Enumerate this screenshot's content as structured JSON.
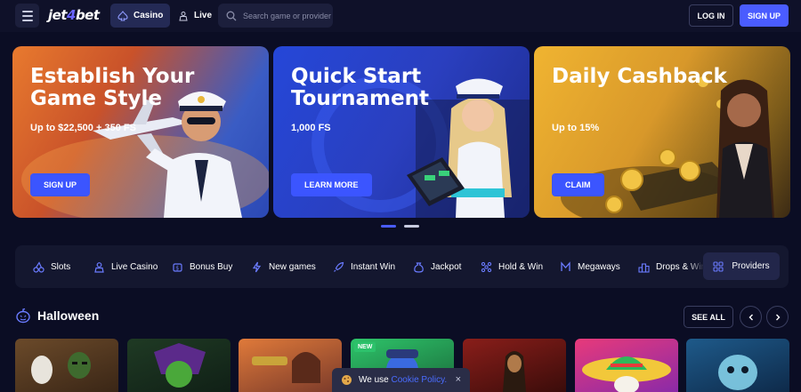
{
  "header": {
    "logo": {
      "prefix": "jet",
      "num": "4",
      "suffix": "bet"
    },
    "nav": [
      {
        "label": "Casino",
        "icon": "spade-icon"
      },
      {
        "label": "Live",
        "icon": "dealer-icon"
      }
    ],
    "search_placeholder": "Search game or provider",
    "login_label": "LOG IN",
    "signup_label": "SIGN UP"
  },
  "banners": [
    {
      "title": "Establish Your Game Style",
      "subtitle": "Up to $22,500 + 350 FS",
      "cta": "SIGN UP",
      "art": "pilot-with-airplane"
    },
    {
      "title": "Quick Start Tournament",
      "subtitle": "1,000 FS",
      "cta": "LEARN MORE",
      "art": "stewardess-with-tablet"
    },
    {
      "title": "Daily Cashback",
      "subtitle": "Up to 15%",
      "cta": "CLAIM",
      "art": "woman-with-gold-coins"
    }
  ],
  "carousel": {
    "slides": 2,
    "active": 1
  },
  "categories": [
    {
      "label": "Slots",
      "icon": "cherries-icon"
    },
    {
      "label": "Live Casino",
      "icon": "dealer-icon"
    },
    {
      "label": "Bonus Buy",
      "icon": "money-bag-icon"
    },
    {
      "label": "New games",
      "icon": "lightning-icon"
    },
    {
      "label": "Instant Win",
      "icon": "rocket-icon"
    },
    {
      "label": "Jackpot",
      "icon": "coin-bag-icon"
    },
    {
      "label": "Hold & Win",
      "icon": "grid-dots-icon"
    },
    {
      "label": "Megaways",
      "icon": "m-letter-icon"
    },
    {
      "label": "Drops & Wins",
      "icon": "podium-icon"
    }
  ],
  "providers_label": "Providers",
  "section": {
    "title": "Halloween",
    "icon": "pumpkin-icon",
    "see_all_label": "SEE ALL"
  },
  "games": [
    {
      "art": "zombie-clowns",
      "badge": ""
    },
    {
      "art": "green-skull-wizard",
      "badge": ""
    },
    {
      "art": "gunslinger-girl",
      "badge": ""
    },
    {
      "art": "blue-bird-character",
      "badge": "NEW"
    },
    {
      "art": "dark-warrior",
      "badge": ""
    },
    {
      "art": "sombrero-skull",
      "badge": ""
    },
    {
      "art": "blue-monster",
      "badge": ""
    }
  ],
  "cookie": {
    "text": "We use",
    "link": "Cookie Policy.",
    "close": "×"
  },
  "colors": {
    "background": "#0b0d24",
    "accent": "#4a5cff",
    "surface": "#14172f"
  }
}
